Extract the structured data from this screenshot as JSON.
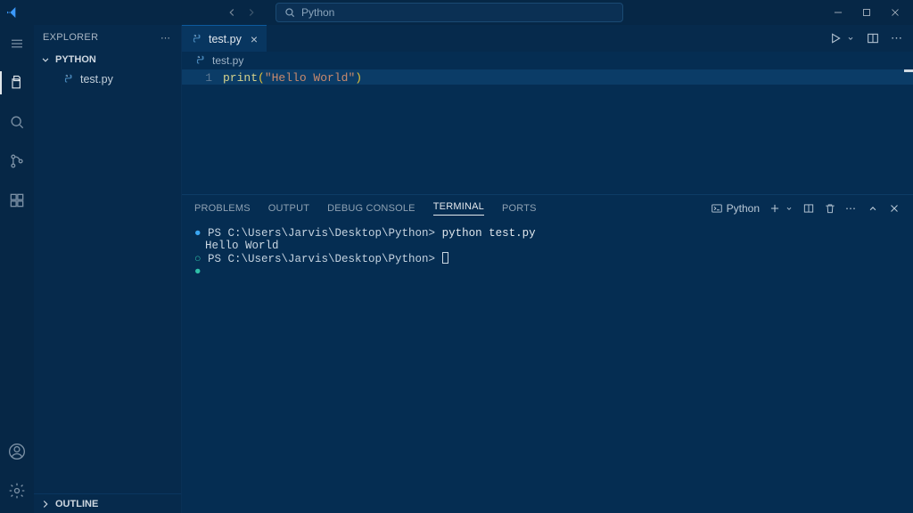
{
  "title_bar": {
    "search_placeholder": "Python"
  },
  "sidebar": {
    "title": "EXPLORER",
    "folder": "PYTHON",
    "files": [
      "test.py"
    ],
    "outline": "OUTLINE"
  },
  "tabs": [
    {
      "label": "test.py"
    }
  ],
  "breadcrumb": {
    "file": "test.py"
  },
  "editor": {
    "line_number": "1",
    "fn": "print",
    "open": "(",
    "string": "\"Hello World\"",
    "close": ")"
  },
  "panel": {
    "tabs": {
      "problems": "PROBLEMS",
      "output": "OUTPUT",
      "debug_console": "DEBUG CONSOLE",
      "terminal": "TERMINAL",
      "ports": "PORTS"
    },
    "shell_label": "Python",
    "terminal_lines": {
      "prompt1": "PS C:\\Users\\Jarvis\\Desktop\\Python> ",
      "cmd1": "python test.py",
      "out1": "Hello World",
      "prompt2": "PS C:\\Users\\Jarvis\\Desktop\\Python> "
    }
  }
}
